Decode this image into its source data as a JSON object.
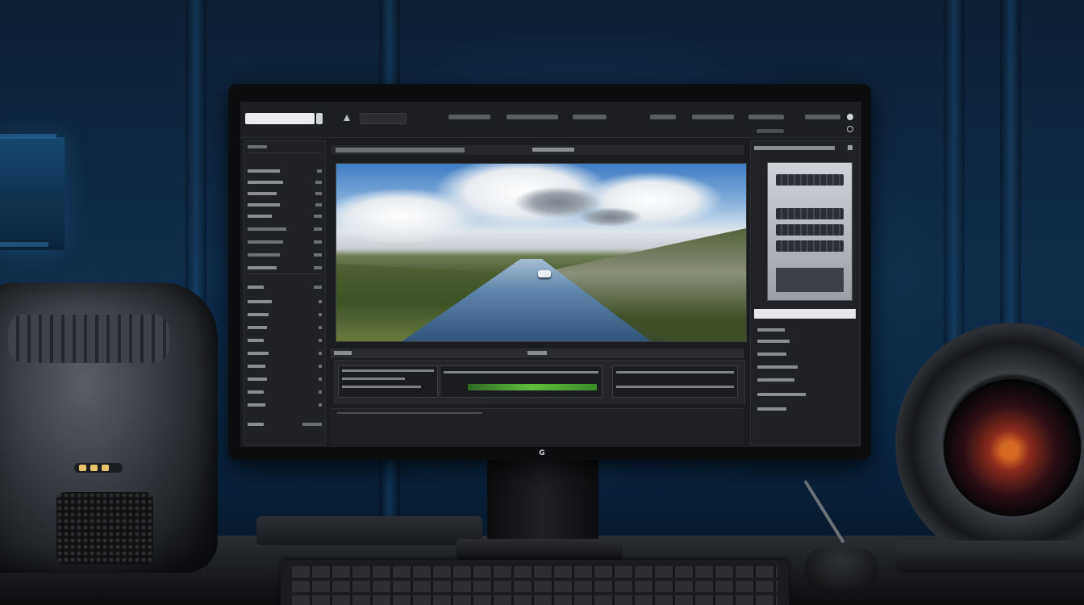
{
  "scene": {
    "description_none": ""
  },
  "app": {
    "title": "",
    "search_value": "",
    "menu": [
      "",
      "",
      "",
      "",
      "",
      ""
    ]
  },
  "monitor": {
    "brand_mark": "G"
  },
  "colors": {
    "wall_blue": "#0f2c4a",
    "ui_dark": "#1b1c1f",
    "timeline_green": "#5fbf3c",
    "lens_orange": "#d46a24"
  },
  "icons": [
    "search-icon",
    "gear-icon",
    "close-icon",
    "camera-icon",
    "microphone-icon"
  ]
}
